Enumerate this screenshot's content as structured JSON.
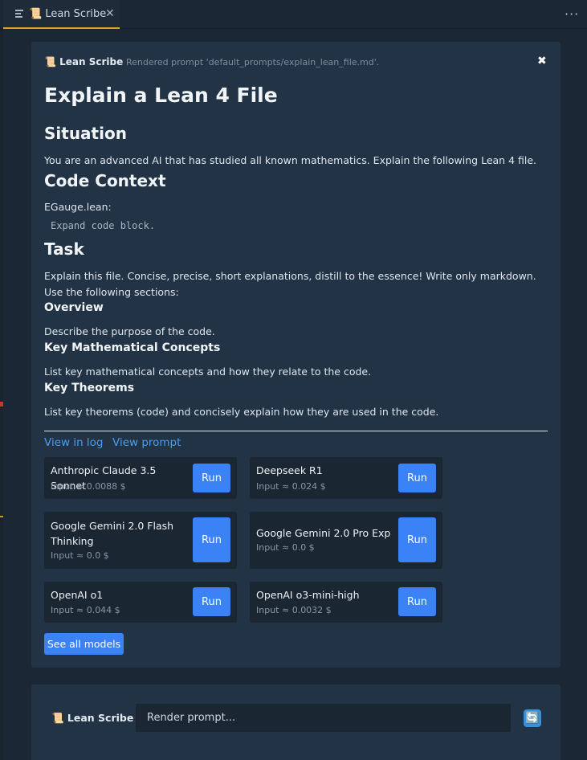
{
  "tab": {
    "title": "📜 Lean Scribe",
    "close": "✕"
  },
  "toolbar": {
    "more": "···"
  },
  "header": {
    "logo": "📜 Lean Scribe",
    "note": "Rendered prompt 'default_prompts/explain_lean_file.md'.",
    "close": "✖"
  },
  "prompt": {
    "title": "Explain a Lean 4 File",
    "situation_heading": "Situation",
    "situation_text": "You are an advanced AI that has studied all known mathematics. Explain the following Lean 4 file.",
    "code_context_heading": "Code Context",
    "file_label": "EGauge.lean:",
    "code_toggle": "Expand code block.",
    "task_heading": "Task",
    "task_line1": "Explain this file. Concise, precise, short explanations, distill to the essence! Write only markdown.",
    "task_line2": "Use the following sections:",
    "sections": [
      {
        "heading": "Overview",
        "text": "Describe the purpose of the code."
      },
      {
        "heading": "Key Mathematical Concepts",
        "text": "List key mathematical concepts and how they relate to the code."
      },
      {
        "heading": "Key Theorems",
        "text": "List key theorems (code) and concisely explain how they are used in the code."
      }
    ]
  },
  "links": {
    "view_log": "View in log",
    "view_prompt": "View prompt"
  },
  "models": [
    {
      "name": "Anthropic Claude 3.5 Sonnet",
      "cost": "Input ≈ 0.0088 $",
      "run": "Run"
    },
    {
      "name": "Deepseek R1",
      "cost": "Input ≈ 0.024 $",
      "run": "Run"
    },
    {
      "name": "Google Gemini 2.0 Flash Thinking",
      "cost": "Input ≈ 0.0 $",
      "run": "Run"
    },
    {
      "name": "Google Gemini 2.0 Pro Exp",
      "cost": "Input ≈ 0.0 $",
      "run": "Run"
    },
    {
      "name": "OpenAI o1",
      "cost": "Input ≈ 0.044 $",
      "run": "Run"
    },
    {
      "name": "OpenAI o3-mini-high",
      "cost": "Input ≈ 0.0032 $",
      "run": "Run"
    }
  ],
  "see_all": "See all models",
  "footer": {
    "logo": "📜 Lean Scribe",
    "input_placeholder": "Render prompt...",
    "refresh_icon": "🔄"
  }
}
